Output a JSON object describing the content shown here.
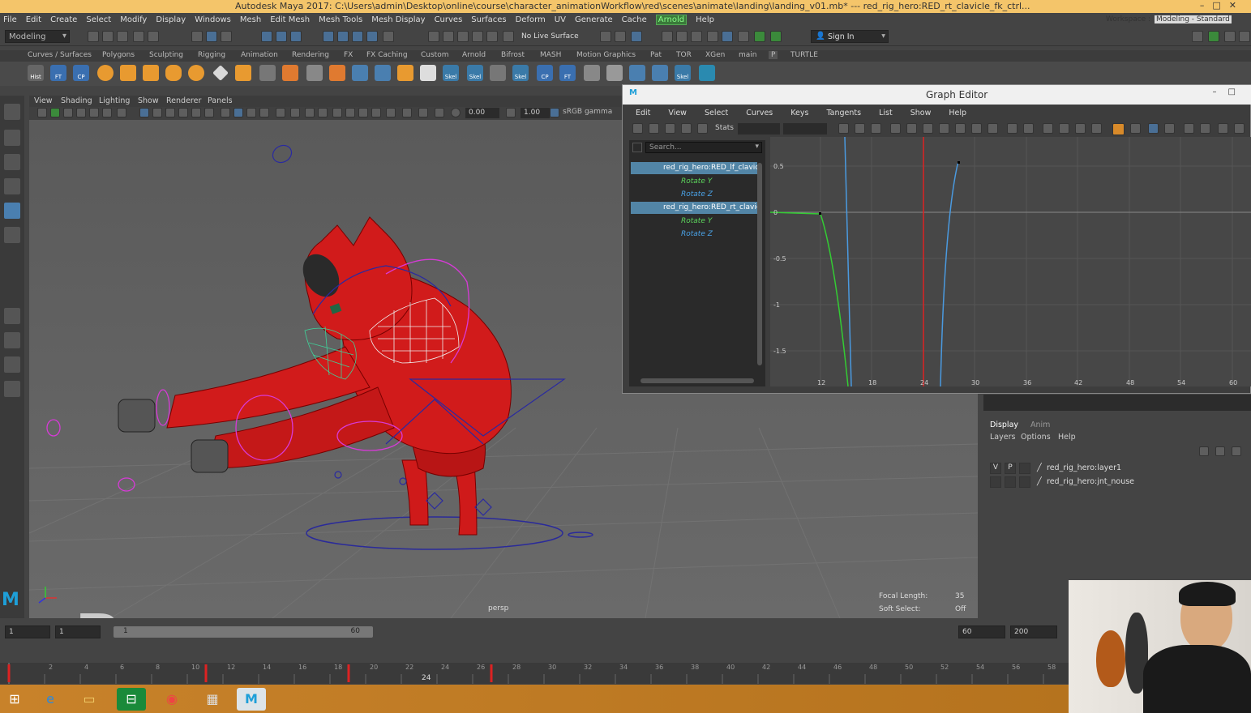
{
  "window": {
    "title": "Autodesk Maya 2017: C:\\Users\\admin\\Desktop\\online\\course\\character_animationWorkflow\\red\\scenes\\animate\\landing\\landing_v01.mb*   ---   red_rig_hero:RED_rt_clavicle_fk_ctrl..."
  },
  "menubar": [
    "File",
    "Edit",
    "Create",
    "Select",
    "Modify",
    "Display",
    "Windows",
    "Mesh",
    "Edit Mesh",
    "Mesh Tools",
    "Mesh Display",
    "Curves",
    "Surfaces",
    "Deform",
    "UV",
    "Generate",
    "Cache",
    "Arnold",
    "Help"
  ],
  "status": {
    "mode": "Modeling",
    "live_surface": "No Live Surface",
    "sign_in": "Sign In",
    "workspace_label": "Workspace :",
    "workspace": "Modeling - Standard"
  },
  "shelf_tabs": [
    "Curves / Surfaces",
    "Polygons",
    "Sculpting",
    "Rigging",
    "Animation",
    "Rendering",
    "FX",
    "FX Caching",
    "Custom",
    "Arnold",
    "Bifrost",
    "MASH",
    "Motion Graphics",
    "Pat",
    "TOR",
    "XGen",
    "main",
    "P",
    "TURTLE"
  ],
  "shelf_icon_labels": [
    "Hist",
    "FT",
    "CP",
    "Skel",
    "Skel",
    "Skel",
    "CP",
    "FT",
    "Skel"
  ],
  "viewport": {
    "menus": [
      "View",
      "Shading",
      "Lighting",
      "Show",
      "Renderer",
      "Panels"
    ],
    "exposure": "0.00",
    "gamma": "1.00",
    "color_space": "sRGB gamma",
    "camera": "persp",
    "focal_length_label": "Focal Length:",
    "focal_length": "35",
    "soft_select_label": "Soft Select:",
    "soft_select": "Off"
  },
  "graph_editor": {
    "title": "Graph Editor",
    "menus": [
      "Edit",
      "View",
      "Select",
      "Curves",
      "Keys",
      "Tangents",
      "List",
      "Show",
      "Help"
    ],
    "stats_label": "Stats",
    "search_placeholder": "Search...",
    "outliner": [
      {
        "label": "red_rig_hero:RED_lf_clavicl",
        "kind": "node"
      },
      {
        "label": "Rotate Y",
        "kind": "y"
      },
      {
        "label": "Rotate Z",
        "kind": "z"
      },
      {
        "label": "red_rig_hero:RED_rt_clavicl",
        "kind": "node"
      },
      {
        "label": "Rotate Y",
        "kind": "y"
      },
      {
        "label": "Rotate Z",
        "kind": "z"
      }
    ],
    "y_ticks": [
      "0.5",
      "0",
      "-0.5",
      "-1",
      "-1.5"
    ],
    "x_ticks": [
      "12",
      "18",
      "24",
      "30",
      "36",
      "42",
      "48",
      "54",
      "60"
    ]
  },
  "layers": {
    "tabs": [
      "Display",
      "Anim"
    ],
    "menus": [
      "Layers",
      "Options",
      "Help"
    ],
    "rows": [
      {
        "v": "V",
        "p": "P",
        "name": "red_rig_hero:layer1"
      },
      {
        "v": "",
        "p": "",
        "name": "red_rig_hero:jnt_nouse"
      }
    ]
  },
  "time_slider": {
    "range_start": "1",
    "playback_start": "1",
    "range_inner_start": "1",
    "range_inner_end": "60",
    "playback_end": "60",
    "range_end": "200"
  },
  "timeline": {
    "ticks": [
      "2",
      "4",
      "6",
      "8",
      "10",
      "12",
      "14",
      "16",
      "18",
      "20",
      "22",
      "24",
      "26",
      "28",
      "30",
      "32",
      "34",
      "36",
      "38",
      "40",
      "42",
      "44",
      "46",
      "48",
      "50",
      "52",
      "54",
      "56",
      "58"
    ],
    "current_frame": "24"
  }
}
